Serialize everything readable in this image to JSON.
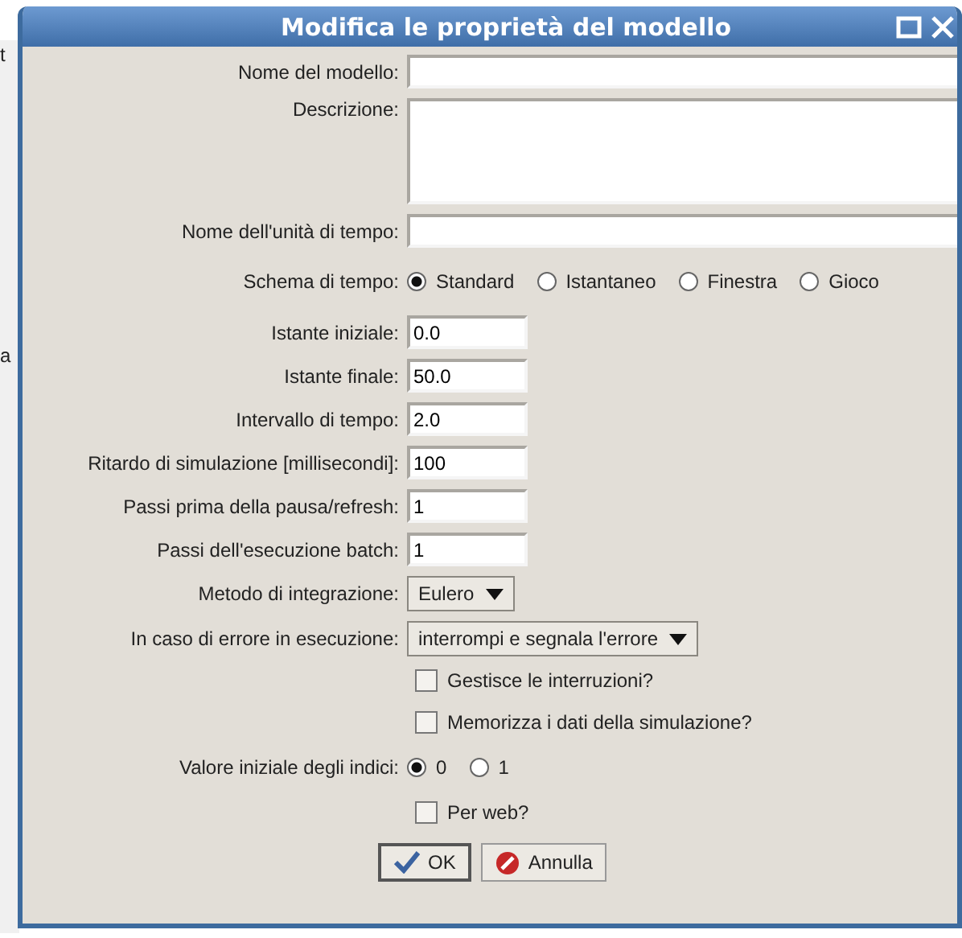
{
  "background_fragments": [
    "t",
    "a"
  ],
  "window": {
    "title": "Modifica le proprietà del modello"
  },
  "rows": [
    {
      "kind": "text",
      "label": "Nome del modello:",
      "value": "",
      "wide": true
    },
    {
      "kind": "textarea",
      "label": "Descrizione:",
      "value": ""
    },
    {
      "kind": "text",
      "label": "Nome dell'unità di tempo:",
      "value": "",
      "wide": true
    },
    {
      "kind": "radio",
      "label": "Schema di tempo:",
      "options": [
        {
          "label": "Standard",
          "selected": true
        },
        {
          "label": "Istantaneo",
          "selected": false
        },
        {
          "label": "Finestra",
          "selected": false
        },
        {
          "label": "Gioco",
          "selected": false
        }
      ]
    },
    {
      "kind": "text",
      "label": "Istante iniziale:",
      "value": "0.0",
      "wide": false
    },
    {
      "kind": "text",
      "label": "Istante finale:",
      "value": "50.0",
      "wide": false
    },
    {
      "kind": "text",
      "label": "Intervallo di tempo:",
      "value": "2.0",
      "wide": false
    },
    {
      "kind": "text",
      "label": "Ritardo di simulazione [millisecondi]:",
      "value": "100",
      "wide": false
    },
    {
      "kind": "text",
      "label": "Passi prima della pausa/refresh:",
      "value": "1",
      "wide": false
    },
    {
      "kind": "text",
      "label": "Passi dell'esecuzione batch:",
      "value": "1",
      "wide": false
    },
    {
      "kind": "dropdown",
      "label": "Metodo di integrazione:",
      "value": "Eulero"
    },
    {
      "kind": "dropdown",
      "label": "In caso di errore in esecuzione:",
      "value": "interrompi e segnala l'errore"
    },
    {
      "kind": "checkbox",
      "label": "Gestisce le interruzioni?",
      "checked": false
    },
    {
      "kind": "checkbox",
      "label": "Memorizza i dati della simulazione?",
      "checked": false
    },
    {
      "kind": "radio",
      "label": "Valore iniziale degli indici:",
      "options": [
        {
          "label": "0",
          "selected": true
        },
        {
          "label": "1",
          "selected": false
        }
      ]
    },
    {
      "kind": "checkbox",
      "label": "Per web?",
      "checked": false
    }
  ],
  "buttons": [
    {
      "kind": "ok",
      "label": "OK",
      "default": true
    },
    {
      "kind": "cancel",
      "label": "Annulla",
      "default": false
    }
  ]
}
